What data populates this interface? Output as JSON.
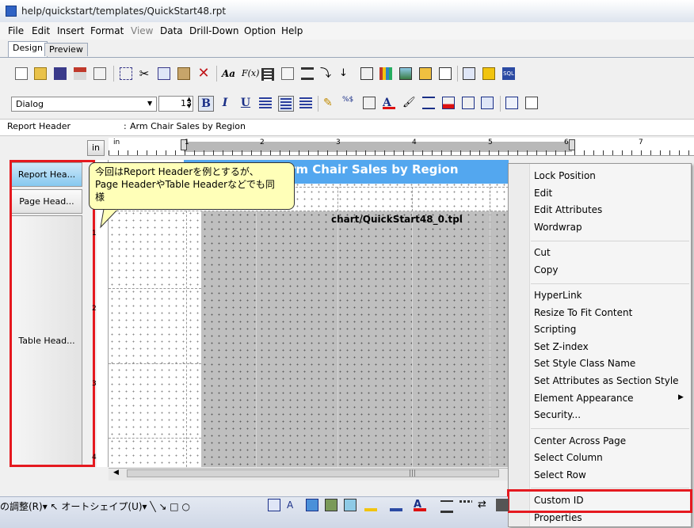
{
  "window": {
    "title": "help/quickstart/templates/QuickStart48.rpt"
  },
  "menu": {
    "items": [
      "File",
      "Edit",
      "Insert",
      "Format",
      "View",
      "Data",
      "Drill-Down",
      "Option",
      "Help"
    ]
  },
  "tabs": {
    "design": "Design",
    "preview": "Preview"
  },
  "format_toolbar": {
    "font_name": "Dialog",
    "font_size": "13",
    "bold": "B",
    "italic": "I",
    "underline": "U"
  },
  "property_bar": {
    "label": "Report Header",
    "colon": ":",
    "value": "Arm Chair Sales by Region"
  },
  "ruler": {
    "unit": "in",
    "marks": [
      "in",
      "1",
      "2",
      "3",
      "4",
      "5",
      "6",
      "7"
    ],
    "vertical_marks": [
      "1",
      "2",
      "3",
      "4"
    ]
  },
  "sections": {
    "report_header": "Report Hea...",
    "page_header": "Page Head...",
    "table_header": "Table Head..."
  },
  "canvas": {
    "report_title": "rm Chair Sales by Region",
    "chart_label": "chart/QuickStart48_0.tpl"
  },
  "callout": {
    "line1": "今回はReport Headerを例とするが、",
    "line2": "Page HeaderやTable Headerなどでも同",
    "line3": "様"
  },
  "context_menu": {
    "group1": [
      "Lock Position",
      "Edit",
      "Edit Attributes",
      "Wordwrap"
    ],
    "group2": [
      "Cut",
      "Copy"
    ],
    "group3": [
      "HyperLink",
      "Resize To Fit Content",
      "Scripting",
      "Set Z-index",
      "Set Style Class Name",
      "Set Attributes as Section Style",
      "Element Appearance",
      "Security..."
    ],
    "group4": [
      "Center Across Page",
      "Select Column",
      "Select Row"
    ],
    "group5": [
      "Custom ID",
      "Properties"
    ],
    "submenu_arrow": "▶"
  },
  "office_bar": {
    "text": "の調整(R)▾ ↖  オートシェイプ(U)▾  ╲  ↘  □  ○"
  },
  "scroll": {
    "grip": "|||"
  },
  "colors": {
    "highlight": "#e5191f",
    "header_band": "#53a7ef",
    "callout_bg": "#ffffb8"
  }
}
